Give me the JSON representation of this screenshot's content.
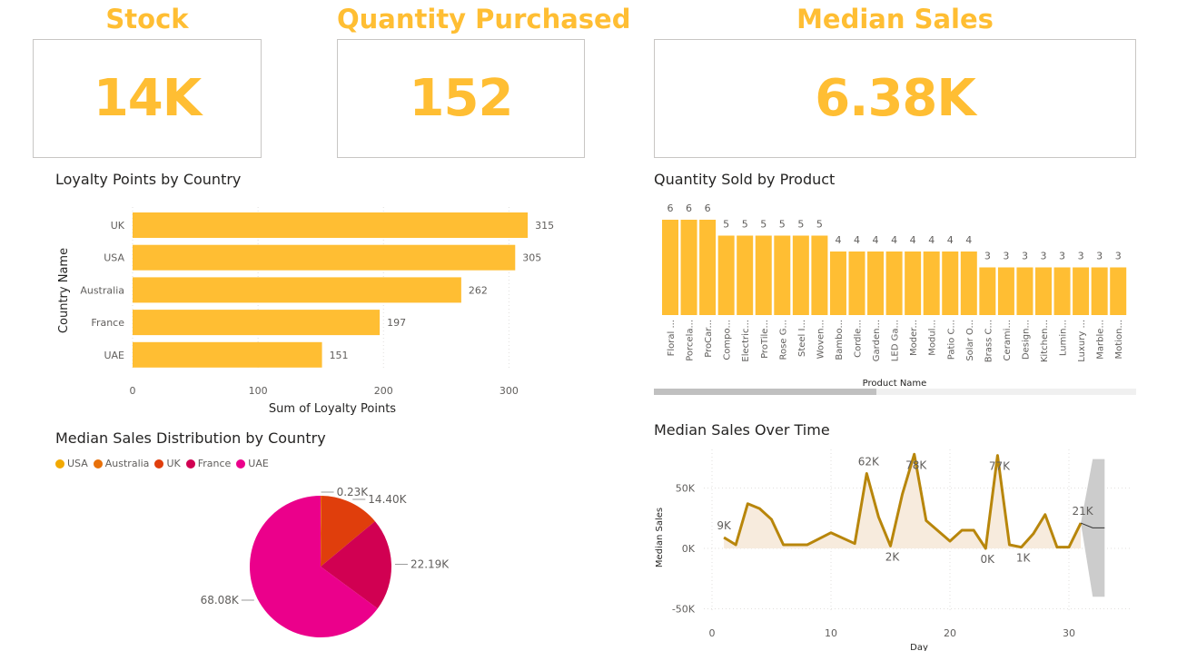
{
  "kpis": {
    "stock": {
      "title": "Stock",
      "value": "14K"
    },
    "quantity": {
      "title": "Quantity Purchased",
      "value": "152"
    },
    "median": {
      "title": "Median Sales",
      "value": "6.38K"
    }
  },
  "colors": {
    "accent": "#FFBE33",
    "line": "#B8860B",
    "area": "#F7EBDD",
    "forecast": "#CCCCCC"
  },
  "loyalty": {
    "title": "Loyalty Points by Country",
    "chart_data": {
      "type": "bar",
      "orientation": "horizontal",
      "categories": [
        "UK",
        "USA",
        "Australia",
        "France",
        "UAE"
      ],
      "values": [
        315,
        305,
        262,
        197,
        151
      ],
      "xlabel": "Sum of Loyalty Points",
      "ylabel": "Country Name",
      "xlim": [
        0,
        320
      ],
      "xticks": [
        "0",
        "100",
        "200",
        "300"
      ]
    }
  },
  "pie": {
    "title": "Median Sales Distribution by Country",
    "chart_data": {
      "type": "pie",
      "categories": [
        "USA",
        "Australia",
        "UK",
        "France",
        "UAE"
      ],
      "values": [
        0.23,
        14.4,
        22.19,
        68.08
      ],
      "slices": [
        {
          "name": "Australia",
          "value": 0.23,
          "label": "0.23K",
          "color": "#E8710A"
        },
        {
          "name": "UK",
          "value": 14.4,
          "label": "14.40K",
          "color": "#E03E0C"
        },
        {
          "name": "France",
          "value": 22.19,
          "label": "22.19K",
          "color": "#D10052"
        },
        {
          "name": "UAE",
          "value": 68.08,
          "label": "68.08K",
          "color": "#EB008B"
        }
      ],
      "legend": [
        {
          "name": "USA",
          "color": "#F2A900"
        },
        {
          "name": "Australia",
          "color": "#E8710A"
        },
        {
          "name": "UK",
          "color": "#E03E0C"
        },
        {
          "name": "France",
          "color": "#D10052"
        },
        {
          "name": "UAE",
          "color": "#EB008B"
        }
      ],
      "legend_position": "top-left"
    }
  },
  "products": {
    "title": "Quantity Sold by Product",
    "chart_data": {
      "type": "bar",
      "categories": [
        "Floral ...",
        "Porcela...",
        "ProCar...",
        "Compo...",
        "Electric...",
        "ProTile...",
        "Rose G...",
        "Steel I...",
        "Woven...",
        "Bambo...",
        "Cordle...",
        "Garden...",
        "LED Ga...",
        "Moder...",
        "Modul...",
        "Patio C...",
        "Solar O...",
        "Brass C...",
        "Cerami...",
        "Design...",
        "Kitchen...",
        "Lumin...",
        "Luxury ...",
        "Marble...",
        "Motion..."
      ],
      "values": [
        6,
        6,
        6,
        5,
        5,
        5,
        5,
        5,
        5,
        4,
        4,
        4,
        4,
        4,
        4,
        4,
        4,
        3,
        3,
        3,
        3,
        3,
        3,
        3,
        3
      ],
      "xlabel": "Product Name",
      "ylim": [
        0,
        6
      ]
    }
  },
  "time": {
    "title": "Median Sales Over Time",
    "chart_data": {
      "type": "area",
      "x": [
        1,
        2,
        3,
        4,
        5,
        6,
        7,
        8,
        10,
        12,
        13,
        14,
        15,
        16,
        17,
        18,
        20,
        21,
        22,
        23,
        24,
        25,
        26,
        27,
        28,
        29,
        30,
        31
      ],
      "y": [
        9,
        3,
        37,
        33,
        24,
        3,
        3,
        3,
        13,
        4,
        62,
        26,
        2,
        45,
        78,
        23,
        6,
        15,
        15,
        0,
        77,
        3,
        1,
        12,
        28,
        1,
        1,
        21
      ],
      "forecast": {
        "x": [
          31,
          32,
          33
        ],
        "y": [
          21,
          17,
          17
        ],
        "upper": [
          21,
          74,
          74
        ],
        "lower": [
          21,
          -40,
          -40
        ]
      },
      "annotations": [
        {
          "x": 1,
          "y": 9,
          "label": "9K",
          "pos": "above"
        },
        {
          "x": 13,
          "y": 62,
          "label": "62K",
          "pos": "above"
        },
        {
          "x": 15,
          "y": 2,
          "label": "2K",
          "pos": "below"
        },
        {
          "x": 17,
          "y": 78,
          "label": "78K",
          "pos": "below"
        },
        {
          "x": 23,
          "y": 0,
          "label": "0K",
          "pos": "below"
        },
        {
          "x": 24,
          "y": 77,
          "label": "77K",
          "pos": "below"
        },
        {
          "x": 26,
          "y": 1,
          "label": "1K",
          "pos": "below"
        },
        {
          "x": 31,
          "y": 21,
          "label": "21K",
          "pos": "above"
        }
      ],
      "xlabel": "Day",
      "ylabel": "Median Sales",
      "xlim": [
        0,
        35
      ],
      "ylim": [
        -50,
        80
      ],
      "xticks": [
        "0",
        "10",
        "20",
        "30"
      ],
      "yticks": [
        "-50K",
        "0K",
        "50K"
      ],
      "grid": true
    }
  }
}
